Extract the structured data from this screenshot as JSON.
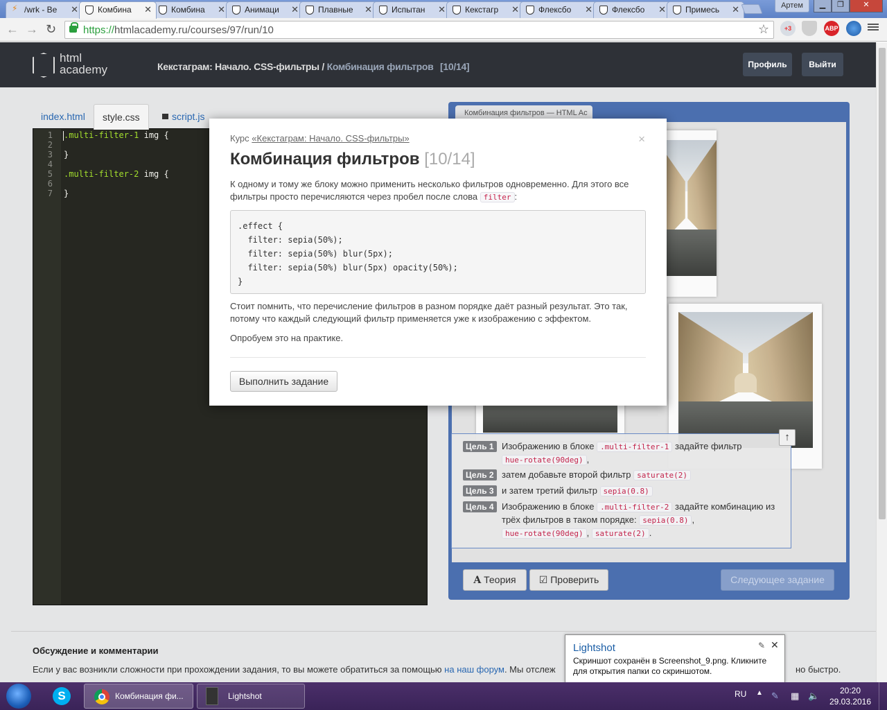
{
  "browser": {
    "tabs": [
      {
        "label": "/wrk - Ве",
        "icon": "bolt-icon"
      },
      {
        "label": "Комбина",
        "icon": "htmlacademy-icon",
        "active": true
      },
      {
        "label": "Комбина",
        "icon": "htmlacademy-icon"
      },
      {
        "label": "Анимаци",
        "icon": "htmlacademy-icon"
      },
      {
        "label": "Плавные",
        "icon": "htmlacademy-icon"
      },
      {
        "label": "Испытан",
        "icon": "htmlacademy-icon"
      },
      {
        "label": "Кекстагр",
        "icon": "htmlacademy-icon"
      },
      {
        "label": "Флексбо",
        "icon": "htmlacademy-icon"
      },
      {
        "label": "Флексбо",
        "icon": "htmlacademy-icon"
      },
      {
        "label": "Примесь",
        "icon": "htmlacademy-icon"
      }
    ],
    "user": "Артем",
    "url_scheme": "https://",
    "url_rest": "htmlacademy.ru/courses/97/run/10",
    "ext_badge": "+3",
    "abp_label": "ABP"
  },
  "site": {
    "logo_line1": "html",
    "logo_line2": "academy",
    "crumb_course": "Кекстаграм: Начало. CSS-фильтры /",
    "crumb_current": "Комбинация фильтров",
    "crumb_count": "[10/14]",
    "profile_label": "Профиль",
    "logout_label": "Выйти"
  },
  "editor": {
    "tabs": [
      "index.html",
      "style.css",
      "script.js"
    ],
    "line_numbers": [
      "1",
      "2",
      "3",
      "4",
      "5",
      "6",
      "7"
    ],
    "lines": [
      {
        "sel": ".multi-filter-1",
        "rest": " img {"
      },
      {
        "sel": "",
        "rest": ""
      },
      {
        "sel": "",
        "rest": "}"
      },
      {
        "sel": "",
        "rest": ""
      },
      {
        "sel": ".multi-filter-2",
        "rest": " img {"
      },
      {
        "sel": "",
        "rest": ""
      },
      {
        "sel": "",
        "rest": "}"
      }
    ]
  },
  "preview": {
    "tab_title": "Комбинация фильтров — HTML Ac"
  },
  "goals": [
    {
      "badge": "Цель 1",
      "pre": "Изображению в блоке",
      "code1": ".multi-filter-1",
      "mid": "задайте фильтр",
      "code2": "hue-rotate(90deg)",
      "post": ","
    },
    {
      "badge": "Цель 2",
      "pre": "затем добавьте второй фильтр",
      "code1": "saturate(2)"
    },
    {
      "badge": "Цель 3",
      "pre": "и затем третий фильтр",
      "code1": "sepia(0.8)"
    },
    {
      "badge": "Цель 4",
      "pre": "Изображению в блоке",
      "code1": ".multi-filter-2",
      "mid": "задайте комбинацию из трёх фильтров в таком порядке:",
      "code2": "sepia(0.8)",
      "code3": "hue-rotate(90deg)",
      "code4": "saturate(2)"
    }
  ],
  "buttons": {
    "theory": "Теория",
    "check": "Проверить",
    "next": "Следующее задание"
  },
  "comments": {
    "title": "Обсуждение и комментарии",
    "text_pre": "Если у вас возникли сложности при прохождении задания, то вы можете обратиться за помощью",
    "link": "на наш форум",
    "text_post": ". Мы отслеж",
    "tail": "но быстро."
  },
  "modal": {
    "course_prefix": "Курс",
    "course_link": "«Кекстаграм: Начало. CSS-фильтры»",
    "title": "Комбинация фильтров",
    "count": "[10/14]",
    "p1_pre": "К одному и тому же блоку можно применить несколько фильтров одновременно. Для этого все фильтры просто перечисляются через пробел после слова",
    "p1_code": "filter",
    "p1_post": ":",
    "code": ".effect {\n  filter: sepia(50%);\n  filter: sepia(50%) blur(5px);\n  filter: sepia(50%) blur(5px) opacity(50%);\n}",
    "p2": "Стоит помнить, что перечисление фильтров в разном порядке даёт разный результат. Это так, потому что каждый следующий фильтр применяется уже к изображению с эффектом.",
    "p3": "Опробуем это на практике.",
    "button": "Выполнить задание",
    "close": "×"
  },
  "toast": {
    "title": "Lightshot",
    "message": "Скриншот сохранён в Screenshot_9.png. Кликните для открытия папки со скриншотом."
  },
  "taskbar": {
    "chrome_label": "Комбинация фи...",
    "lightshot_label": "Lightshot",
    "lang": "RU",
    "time": "20:20",
    "date": "29.03.2016"
  }
}
